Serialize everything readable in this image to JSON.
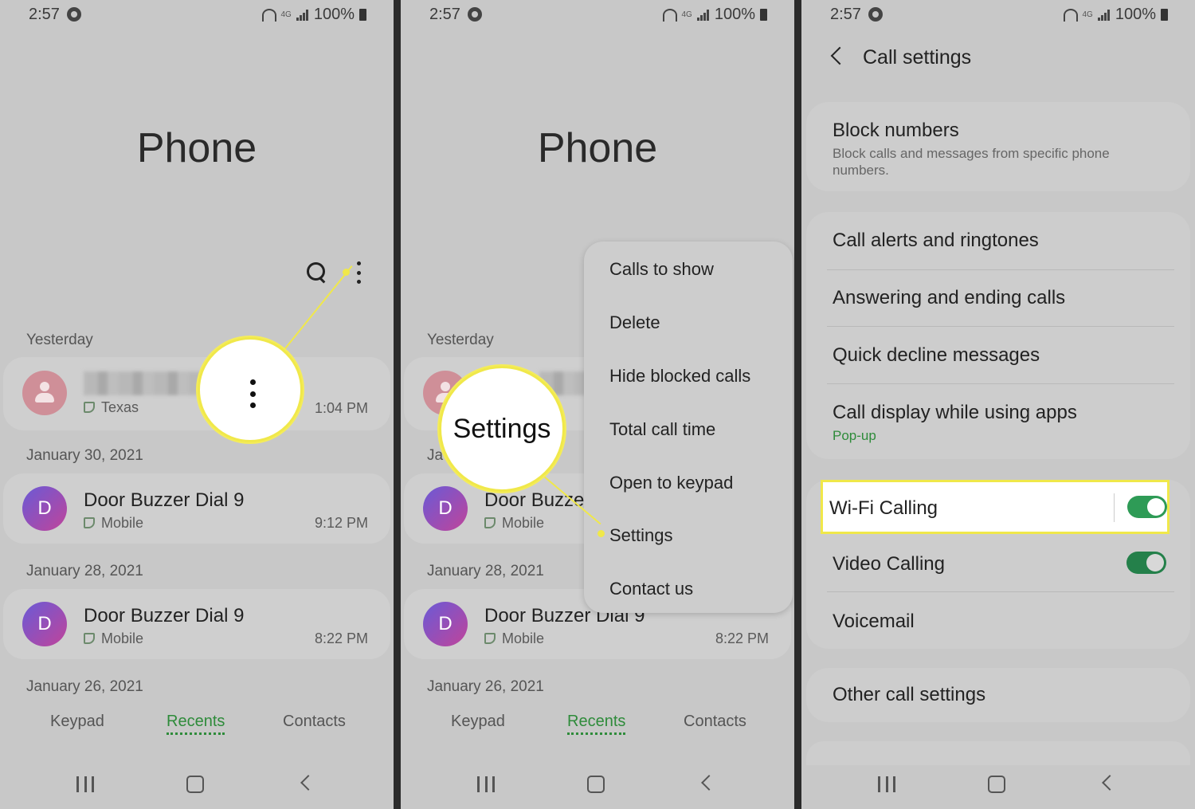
{
  "status": {
    "time": "2:57",
    "network": "4G",
    "battery": "100%"
  },
  "phone": {
    "title": "Phone",
    "sections": {
      "yesterday": "Yesterday",
      "jan30": "January 30, 2021",
      "jan28": "January 28, 2021",
      "jan26": "January 26, 2021",
      "jan_partial": "Ja"
    },
    "calls": [
      {
        "name": "",
        "type": "Texas",
        "time": "1:04 PM"
      },
      {
        "name": "Door Buzzer Dial 9",
        "type": "Mobile",
        "time": "9:12 PM"
      },
      {
        "name": "Door Buzzer Dial 9",
        "type": "Mobile",
        "time": "8:22 PM"
      }
    ],
    "name_trunc_1": "Door Buzze",
    "name_trunc_2": "Door Buzzer Dial 9",
    "tabs": {
      "keypad": "Keypad",
      "recents": "Recents",
      "contacts": "Contacts"
    }
  },
  "menu": {
    "items": [
      "Calls to show",
      "Delete",
      "Hide blocked calls",
      "Total call time",
      "Open to keypad",
      "Settings",
      "Contact us"
    ],
    "callout": "Settings"
  },
  "call_settings": {
    "title": "Call settings",
    "block_title": "Block numbers",
    "block_sub": "Block calls and messages from specific phone numbers.",
    "items": [
      "Call alerts and ringtones",
      "Answering and ending calls",
      "Quick decline messages",
      "Call display while using apps"
    ],
    "call_display_sub": "Pop-up",
    "wifi_calling": "Wi-Fi Calling",
    "video_calling": "Video Calling",
    "voicemail": "Voicemail",
    "other": "Other call settings",
    "wifi_on": true,
    "video_on": true
  },
  "colors": {
    "accent": "#2e8b3a",
    "toggle": "#2e9b56",
    "highlight": "#f0e84a"
  }
}
